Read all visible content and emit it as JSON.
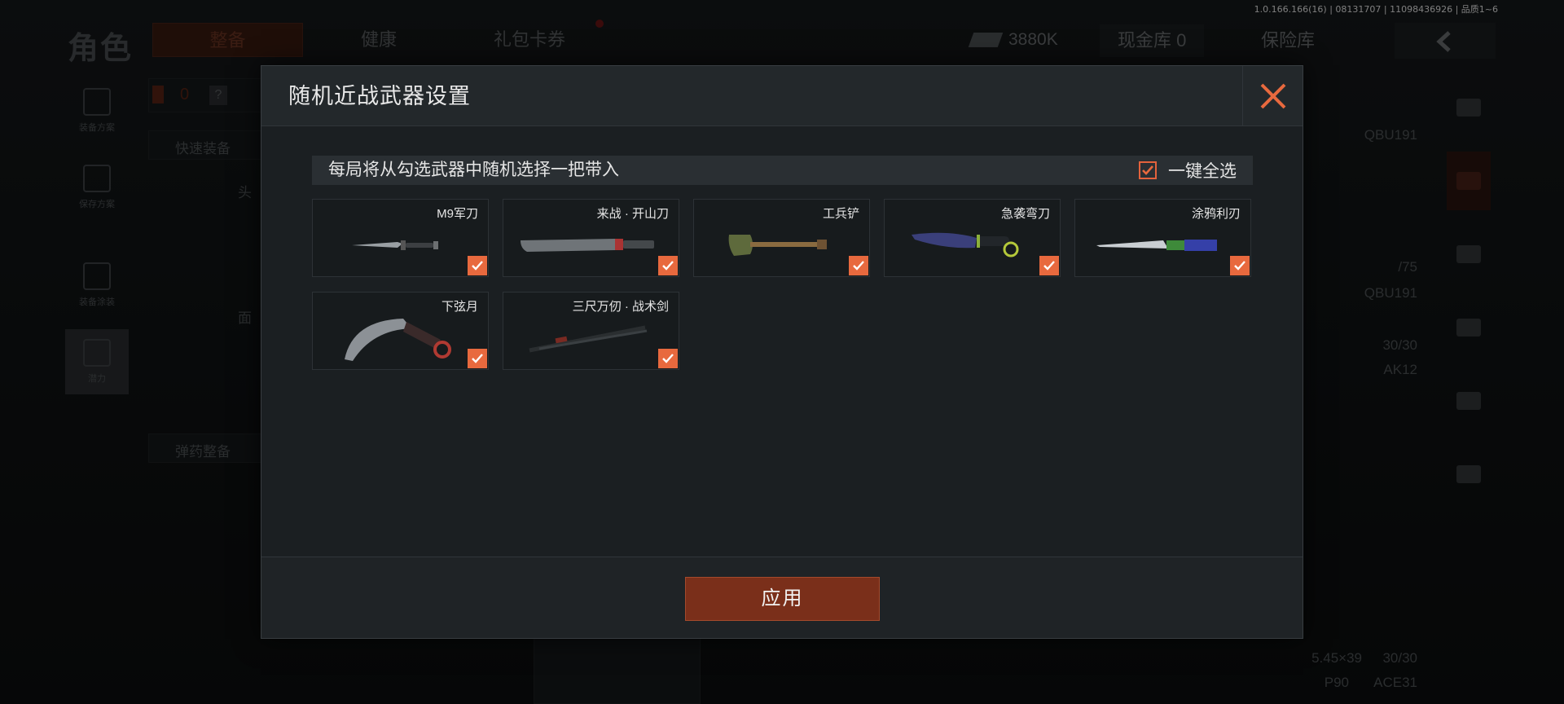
{
  "version": "1.0.166.166(16) | 08131707 | 11098436926 | 品质1~6",
  "background": {
    "title": "角色",
    "tabs": [
      "整备",
      "健康",
      "礼包卡券"
    ],
    "money": "3880K",
    "cash_vault": "现金库 0",
    "safe_vault": "保险库",
    "back_icon": "chevron-left-icon",
    "left_nav": [
      "装备方案",
      "保存方案",
      "装备涂装",
      "潜力"
    ],
    "quick_equip": "快速装备",
    "ammo_equip": "弹药整备",
    "count_badge": "0",
    "help": "?",
    "head_label": "头",
    "face_label": "面",
    "right_items": [
      "QBU191",
      "/75",
      "QBU191",
      "30/30",
      "AK12",
      "5.45×39",
      "30/30",
      "P90",
      "ACE31"
    ]
  },
  "modal": {
    "title": "随机近战武器设置",
    "instruction": "每局将从勾选武器中随机选择一把带入",
    "select_all_label": "一键全选",
    "select_all_checked": true,
    "apply_label": "应用",
    "weapons": [
      {
        "name": "M9军刀",
        "icon": "combat-knife-icon",
        "checked": true
      },
      {
        "name": "来战 · 开山刀",
        "icon": "machete-icon",
        "checked": true
      },
      {
        "name": "工兵铲",
        "icon": "shovel-icon",
        "checked": true
      },
      {
        "name": "急袭弯刀",
        "icon": "curved-blade-icon",
        "checked": true
      },
      {
        "name": "涂鸦利刃",
        "icon": "graffiti-knife-icon",
        "checked": true
      },
      {
        "name": "下弦月",
        "icon": "karambit-icon",
        "checked": true
      },
      {
        "name": "三尺万仞 · 战术剑",
        "icon": "tactical-sword-icon",
        "checked": true
      }
    ]
  },
  "colors": {
    "accent": "#e8693e",
    "apply_button": "#7a2f1a",
    "modal_bg": "#1a1e21"
  }
}
